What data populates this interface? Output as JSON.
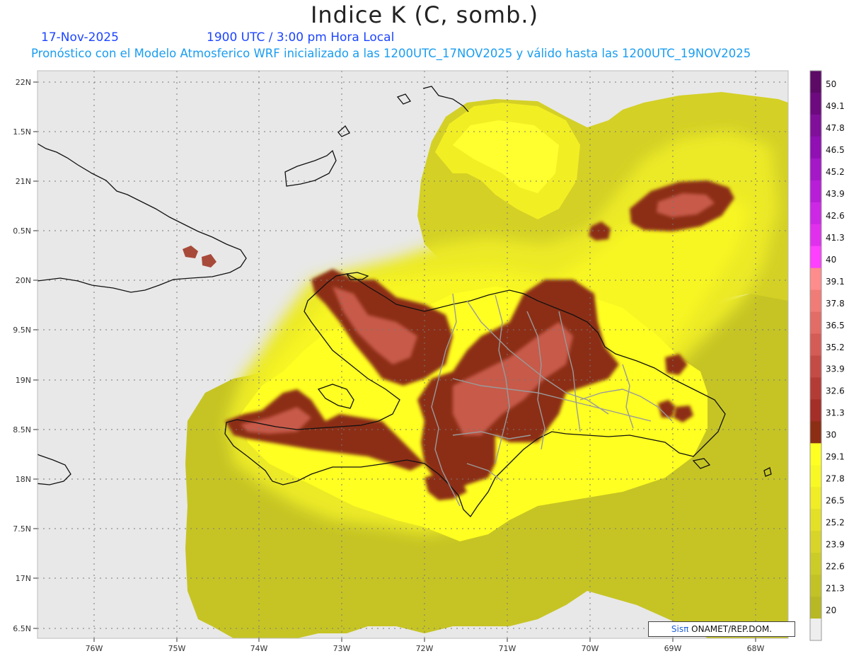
{
  "header": {
    "title": "Indice K (C, somb.)",
    "date": "17-Nov-2025",
    "time": "1900 UTC / 3:00 pm Hora Local",
    "info": "Pronóstico con el Modelo Atmosferico WRF inicializado a las 1200UTC_17NOV2025 y válido hasta las  1200UTC_19NOV2025"
  },
  "axes": {
    "lat_labels": [
      "22N",
      "1.5N",
      "21N",
      "0.5N",
      "20N",
      "9.5N",
      "19N",
      "8.5N",
      "18N",
      "7.5N",
      "17N",
      "6.5N"
    ],
    "lon_labels": [
      "76W",
      "75W",
      "74W",
      "73W",
      "72W",
      "71W",
      "70W",
      "69W",
      "68W"
    ]
  },
  "legend": {
    "labels": [
      "50",
      "49.1",
      "47.8",
      "46.5",
      "45.2",
      "43.9",
      "42.6",
      "41.3",
      "40",
      "39.1",
      "37.8",
      "36.5",
      "35.2",
      "33.9",
      "32.6",
      "31.3",
      "30",
      "29.1",
      "27.8",
      "26.5",
      "25.2",
      "23.9",
      "22.6",
      "21.3",
      "20"
    ],
    "colors": [
      "#5c0a66",
      "#6e0a80",
      "#80109a",
      "#9010b4",
      "#a418c8",
      "#b81ed8",
      "#cc28e6",
      "#e030ee",
      "#ff40ff",
      "#ff8c8c",
      "#f07c78",
      "#e26c66",
      "#d45c56",
      "#c44c46",
      "#b43c36",
      "#a42e28",
      "#8c2e14",
      "#ffff22",
      "#f8f824",
      "#f0ec26",
      "#e4e028",
      "#d8d428",
      "#cccc28",
      "#c2c226",
      "#b8b824",
      "#eeeeee"
    ]
  },
  "credit": {
    "brand": "Sisπ",
    "text": " ONAMET/REP.DOM."
  }
}
